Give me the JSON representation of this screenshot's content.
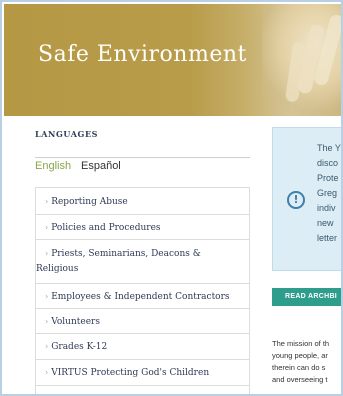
{
  "banner": {
    "title": "Safe Environment"
  },
  "sidebar": {
    "languages_heading": "LANGUAGES",
    "languages": [
      {
        "label": "English",
        "color": "#8aa64a"
      },
      {
        "label": "Español",
        "color": "#333333"
      }
    ],
    "items": [
      {
        "label": "Reporting Abuse"
      },
      {
        "label": "Policies and Procedures"
      },
      {
        "label": "Priests, Seminarians, Deacons &",
        "label2": "Religious"
      },
      {
        "label": "Employees & Independent Contractors"
      },
      {
        "label": "Volunteers"
      },
      {
        "label": "Grades K-12"
      },
      {
        "label": "VIRTUS Protecting God's Children"
      }
    ]
  },
  "alert": {
    "lines": [
      "The Y",
      "disco",
      "Prote",
      "Greg",
      "indiv",
      "new",
      "letter"
    ],
    "icon": "info-circle-icon"
  },
  "read_button": {
    "label": "READ ARCHBI"
  },
  "mission": {
    "lines": [
      "The mission of th",
      "young people, ar",
      "therein can do s",
      "and overseeing t"
    ]
  },
  "colors": {
    "banner": "#b89c4a",
    "alert_bg": "#dcedf5",
    "button": "#2e9d8c",
    "link": "#2e3a55",
    "accent_green": "#8aa64a"
  }
}
